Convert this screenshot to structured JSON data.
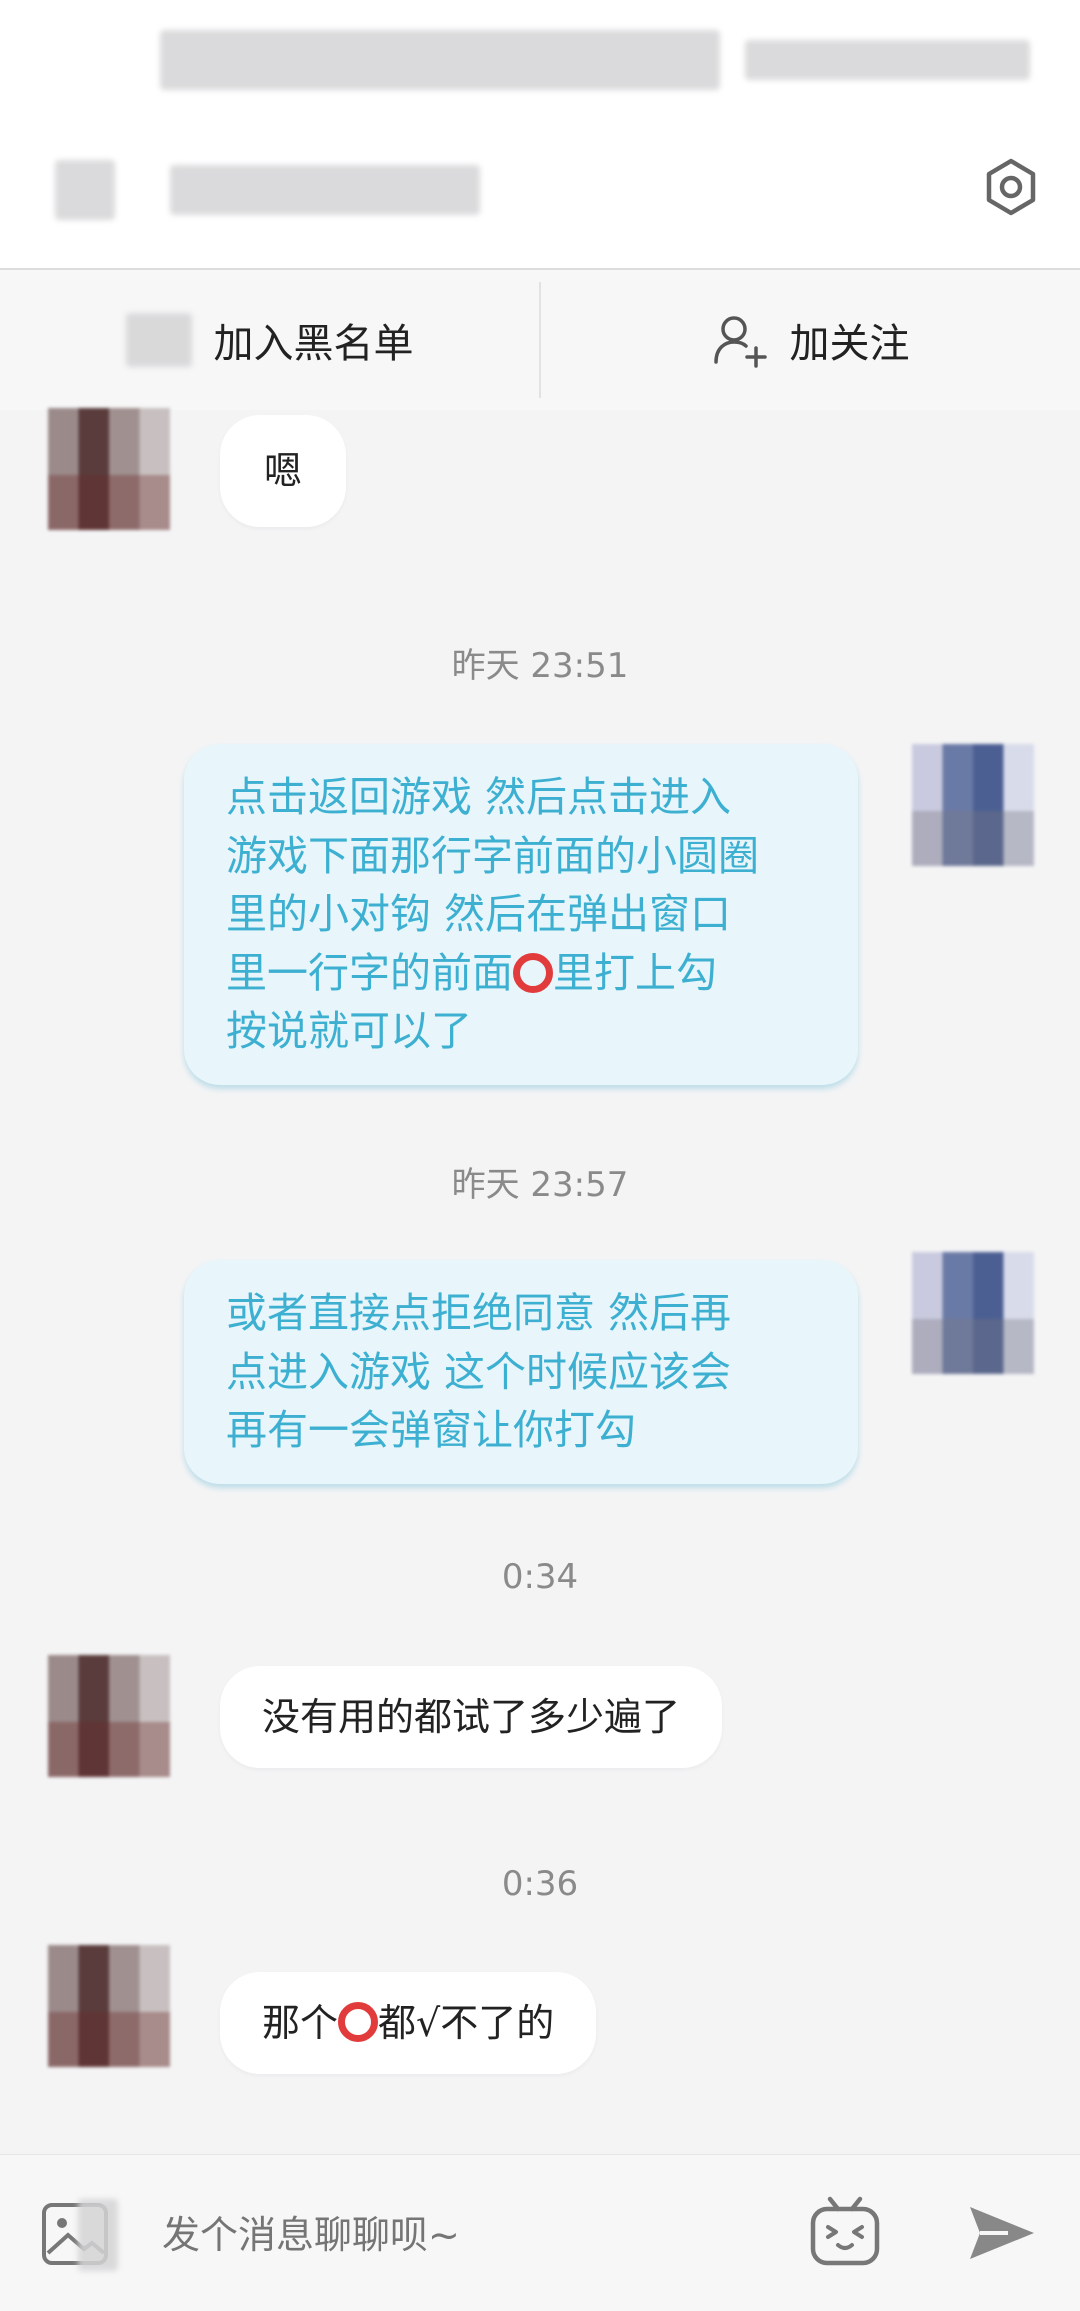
{
  "header": {
    "settings_icon": "settings-hex-icon"
  },
  "actions": {
    "blacklist_label": "加入黑名单",
    "follow_label": "加关注",
    "follow_icon": "add-user-icon"
  },
  "messages": [
    {
      "side": "left",
      "text": "嗯"
    },
    {
      "time": "昨天 23:51"
    },
    {
      "side": "right",
      "lines": [
        "点击返回游戏  然后点击进入",
        "游戏下面那行字前面的小圆圈",
        "里的小对钩 然后在弹出窗口",
        "里一行字的前面",
        "里打上勾",
        "按说就可以了"
      ]
    },
    {
      "time": "昨天 23:57"
    },
    {
      "side": "right",
      "lines": [
        "或者直接点拒绝同意 然后再",
        "点进入游戏 这个时候应该会",
        "再有一会弹窗让你打勾"
      ]
    },
    {
      "time": "0:34"
    },
    {
      "side": "left",
      "text": "没有用的都试了多少遍了"
    },
    {
      "time": "0:36"
    },
    {
      "side": "left",
      "text_a": "那个",
      "text_b": "都√不了的"
    }
  ],
  "input": {
    "placeholder": "发个消息聊聊呗~",
    "image_icon": "image-icon",
    "emoji_icon": "tv-emoji-icon",
    "send_icon": "send-icon"
  },
  "colors": {
    "accent": "#3db0d2",
    "bubble_right_bg": "#e8f6fb",
    "circle_red": "#e23b3b"
  }
}
